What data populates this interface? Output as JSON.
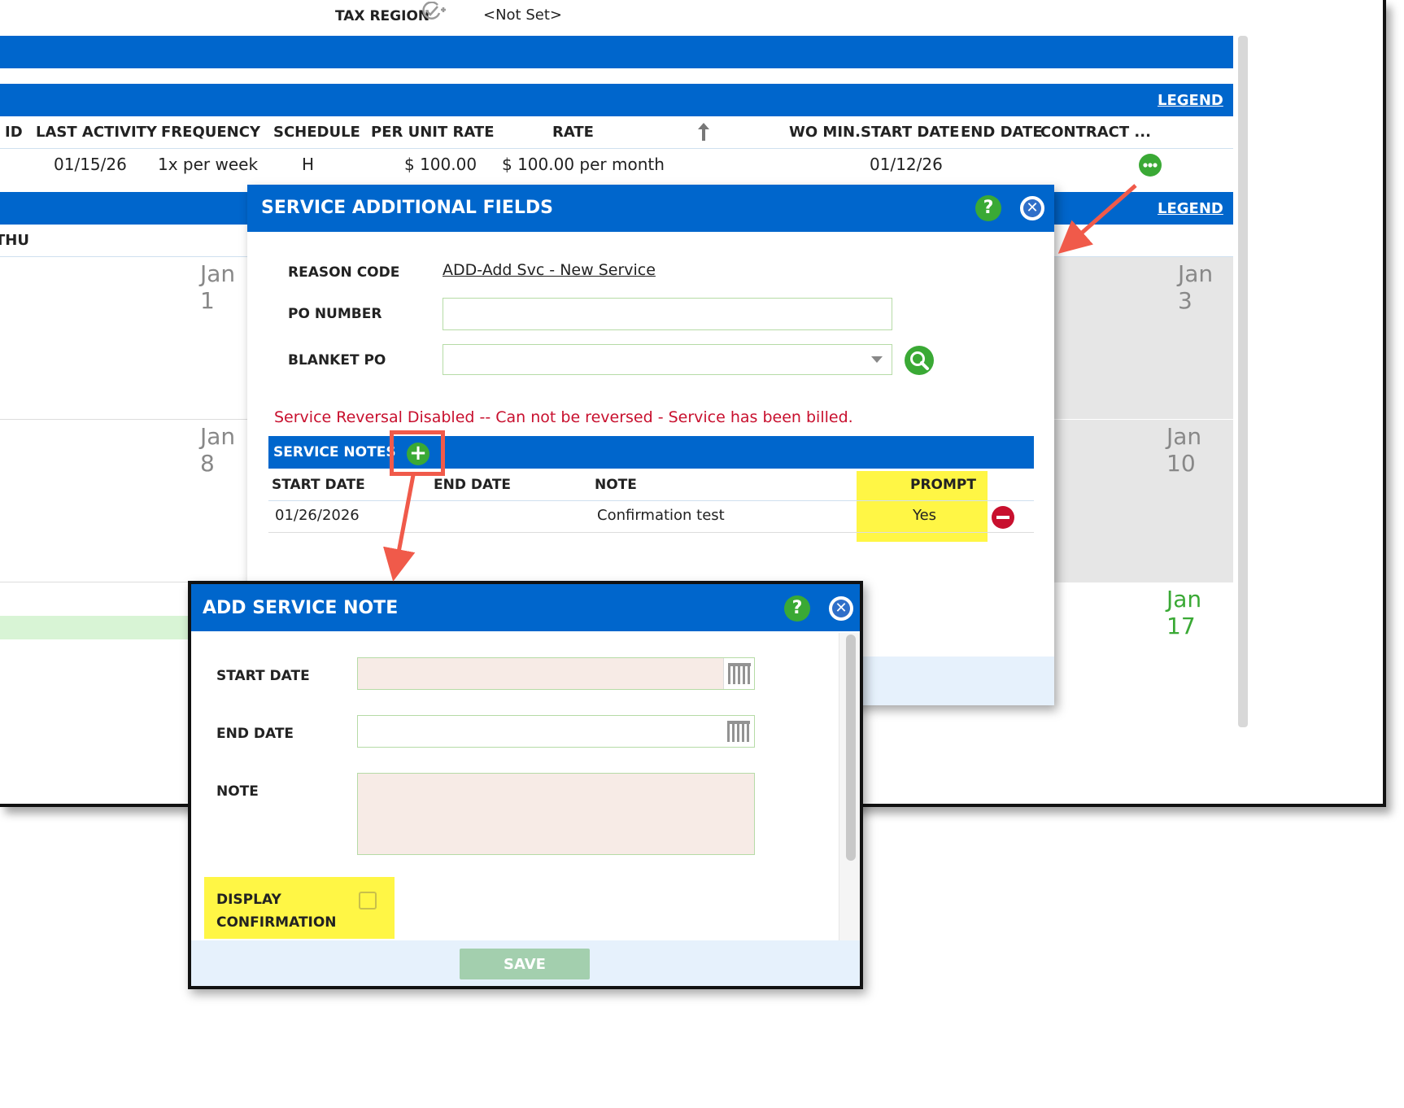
{
  "top": {
    "tax_region_label": "TAX REGION",
    "tax_region_value": "<Not Set>"
  },
  "services_table": {
    "legend": "LEGEND",
    "columns": [
      "ID",
      "LAST ACTIVITY",
      "FREQUENCY",
      "SCHEDULE",
      "PER UNIT RATE",
      "RATE",
      "WO MIN.",
      "START DATE",
      "END DATE",
      "CONTRACT ..."
    ],
    "row": {
      "last_activity": "01/15/26",
      "frequency": "1x per week",
      "schedule": "H",
      "per_unit_rate": "$ 100.00",
      "rate": "$ 100.00 per month",
      "start_date": "01/12/26"
    }
  },
  "calendar": {
    "legend": "LEGEND",
    "day_header": "THU",
    "dates": [
      "Jan 1",
      "Jan 3",
      "Jan 8",
      "Jan 10",
      "Jan 17"
    ]
  },
  "service_additional_fields": {
    "title": "SERVICE ADDITIONAL FIELDS",
    "help": "?",
    "reason_code_label": "REASON CODE",
    "reason_code_value": "ADD-Add Svc - New Service",
    "po_number_label": "PO NUMBER",
    "po_number_value": "",
    "blanket_po_label": "BLANKET PO",
    "blanket_po_value": "",
    "error": "Service Reversal Disabled -- Can not be reversed - Service has been billed.",
    "service_notes": {
      "title": "SERVICE NOTES",
      "columns": [
        "START DATE",
        "END DATE",
        "NOTE",
        "PROMPT"
      ],
      "rows": [
        {
          "start_date": "01/26/2026",
          "end_date": "",
          "note": "Confirmation test",
          "prompt": "Yes"
        }
      ]
    }
  },
  "add_service_note": {
    "title": "ADD SERVICE NOTE",
    "help": "?",
    "start_date_label": "START DATE",
    "start_date_value": "",
    "end_date_label": "END DATE",
    "end_date_value": "",
    "note_label": "NOTE",
    "note_value": "",
    "display_confirmation_label_1": "DISPLAY",
    "display_confirmation_label_2": "CONFIRMATION",
    "display_confirmation_checked": false,
    "save_label": "SAVE"
  },
  "colors": {
    "primary_blue": "#0066cc",
    "help_green": "#3aa935",
    "error_red": "#c8102e",
    "highlight_yellow": "#fff645",
    "annotation_red": "#f05a4a"
  }
}
